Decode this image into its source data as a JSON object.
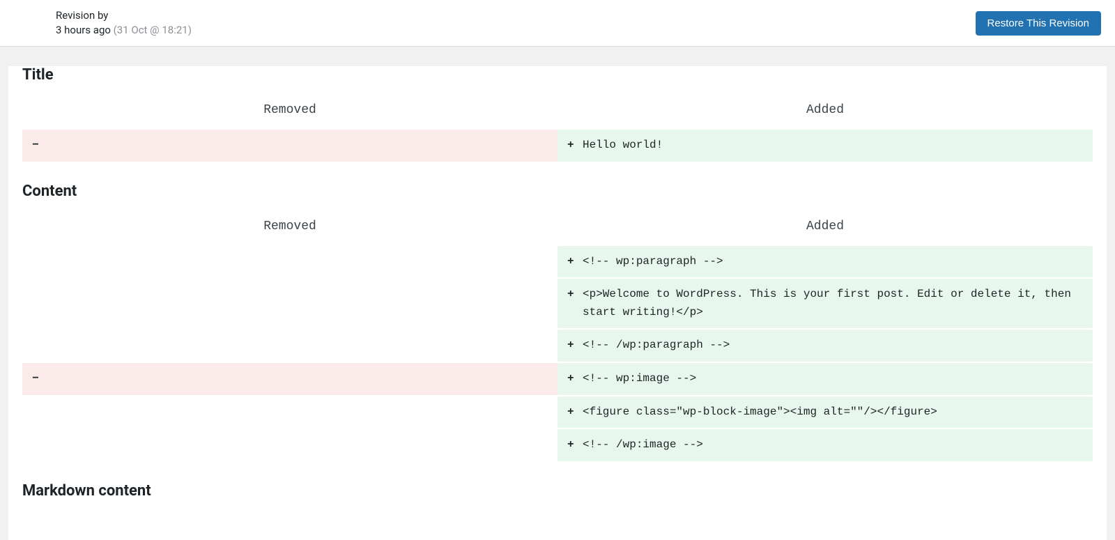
{
  "header": {
    "revision_by_label": "Revision by",
    "time_ago": "3 hours ago",
    "timestamp": "(31 Oct @ 18:21)",
    "restore_label": "Restore This Revision"
  },
  "diff_headers": {
    "removed": "Removed",
    "added": "Added"
  },
  "sections": [
    {
      "heading": "Title",
      "rows": [
        {
          "removed": {
            "sign": "−",
            "text": ""
          },
          "added": {
            "sign": "+",
            "text": "Hello world!"
          }
        }
      ]
    },
    {
      "heading": "Content",
      "rows": [
        {
          "removed": null,
          "added": {
            "sign": "+",
            "text": "<!-- wp:paragraph -->"
          }
        },
        {
          "removed": null,
          "added": {
            "sign": "+",
            "text": "<p>Welcome to WordPress. This is your first post. Edit or delete it, then start writing!</p>"
          }
        },
        {
          "removed": null,
          "added": {
            "sign": "+",
            "text": "<!-- /wp:paragraph -->"
          }
        },
        {
          "removed": {
            "sign": "−",
            "text": ""
          },
          "added": {
            "sign": "+",
            "text": "<!-- wp:image -->"
          }
        },
        {
          "removed": null,
          "added": {
            "sign": "+",
            "text": "<figure class=\"wp-block-image\"><img alt=\"\"/></figure>"
          }
        },
        {
          "removed": null,
          "added": {
            "sign": "+",
            "text": "<!-- /wp:image -->"
          }
        }
      ]
    },
    {
      "heading": "Markdown content",
      "rows": []
    }
  ]
}
